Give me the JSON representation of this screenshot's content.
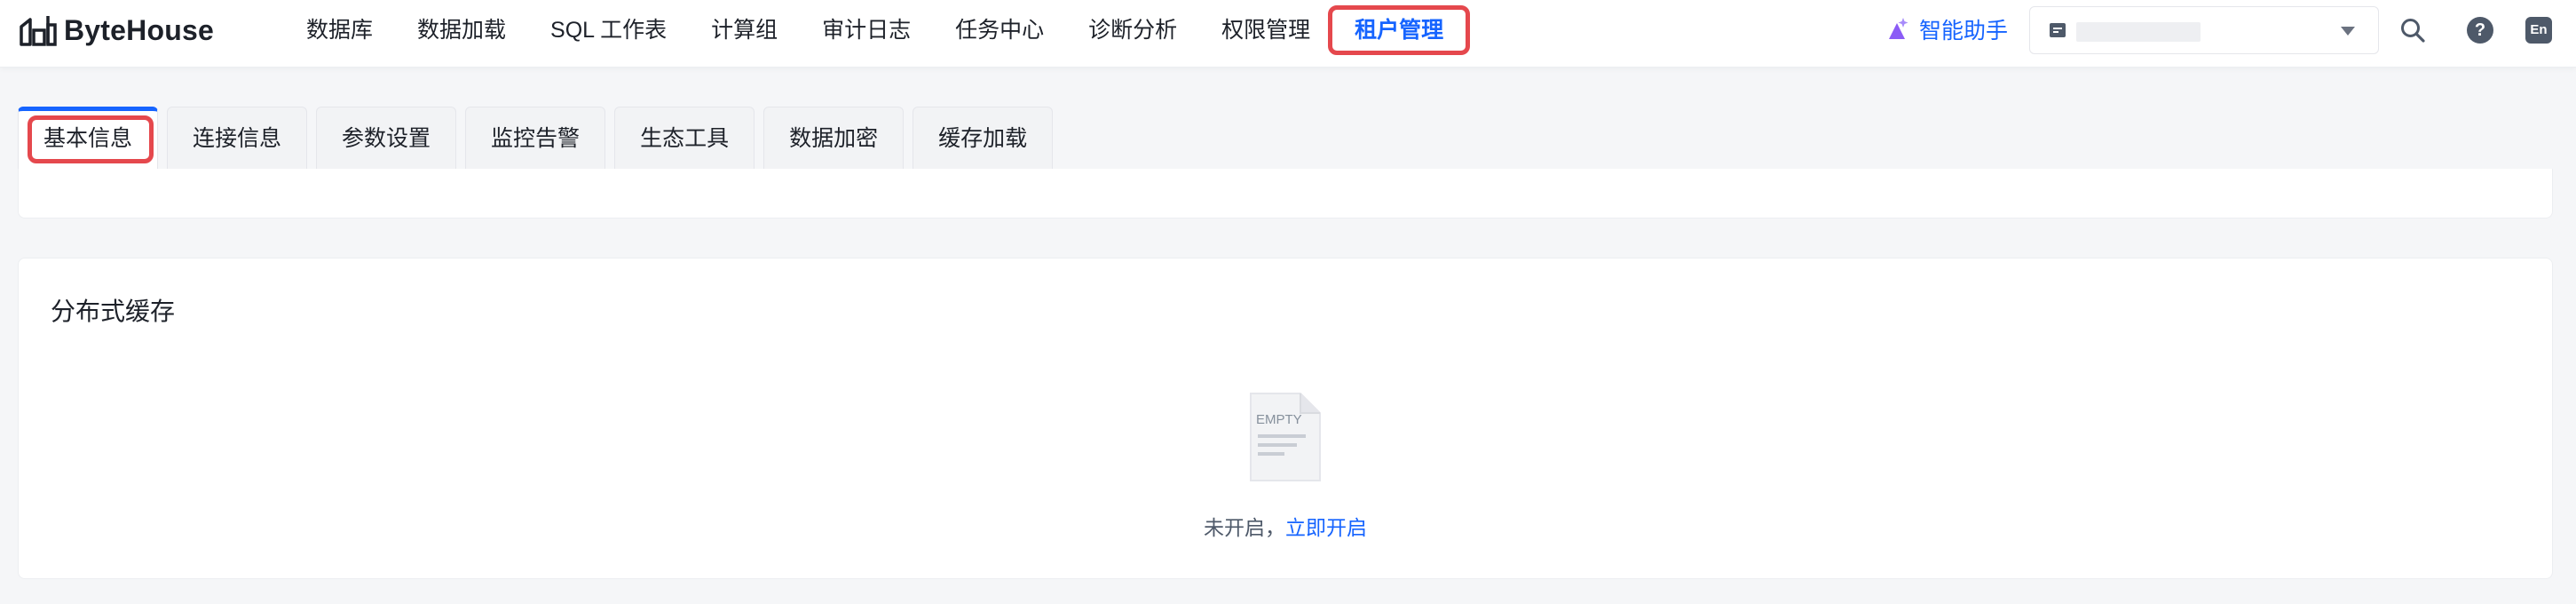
{
  "app": {
    "name": "ByteHouse"
  },
  "nav": {
    "items": [
      {
        "label": "数据库"
      },
      {
        "label": "数据加载"
      },
      {
        "label": "SQL 工作表"
      },
      {
        "label": "计算组"
      },
      {
        "label": "审计日志"
      },
      {
        "label": "任务中心"
      },
      {
        "label": "诊断分析"
      },
      {
        "label": "权限管理"
      },
      {
        "label": "租户管理"
      }
    ],
    "active": "租户管理"
  },
  "header": {
    "assistant_label": "智能助手",
    "lang_label": "En",
    "help_label": "?"
  },
  "tabs": [
    {
      "label": "基本信息"
    },
    {
      "label": "连接信息"
    },
    {
      "label": "参数设置"
    },
    {
      "label": "监控告警"
    },
    {
      "label": "生态工具"
    },
    {
      "label": "数据加密"
    },
    {
      "label": "缓存加载"
    }
  ],
  "section": {
    "title": "分布式缓存",
    "empty_illustration_text": "EMPTY",
    "empty_text": "未开启，",
    "empty_link": "立即开启"
  },
  "colors": {
    "accent": "#1664ff",
    "highlight": "#e5484d"
  }
}
